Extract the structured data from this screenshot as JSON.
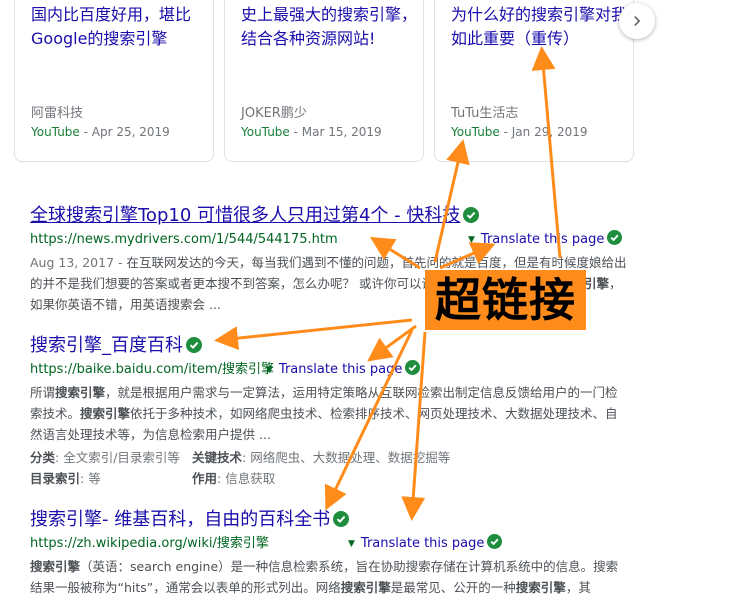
{
  "cards": [
    {
      "title": "国内比百度好用，堪比Google的搜索引擎",
      "author": "阿雷科技",
      "source": "YouTube",
      "date": "Apr 25, 2019"
    },
    {
      "title": "史上最强大的搜索引擎，结合各种资源网站!",
      "author": "JOKER鹏少",
      "source": "YouTube",
      "date": "Mar 15, 2019"
    },
    {
      "title": "为什么好的搜索引擎对我如此重要（重传）",
      "author": "TuTu生活志",
      "source": "YouTube",
      "date": "Jan 29, 2019"
    }
  ],
  "separator": " - ",
  "results": [
    {
      "title": "全球搜索引擎Top10 可惜很多人只用过第4个 - 快科技",
      "url": "https://news.mydrivers.com/1/544/544175.htm",
      "translate": "Translate this page",
      "date": "Aug 13, 2017 - ",
      "snippet_a": "在互联网发达的今天，每当我们遇到不懂的问题，首先问的就是百度，但是有时候度娘给出的并不是我们想要的答案或者更本搜不到答案，怎么办呢？ 或许你可以试试一下下面这个榜上大",
      "snippet_b": "搜索引擎",
      "snippet_c": "，如果你英语不错，用英语搜索会 ..."
    },
    {
      "title": "搜索引擎_百度百科",
      "url": "https://baike.baidu.com/item/搜索引擎",
      "translate": "Translate this page",
      "s1": "所谓",
      "s2": "搜索引擎",
      "s3": "，就是根据用户需求与一定算法，运用特定策略从互联网检索出制定信息反馈给用户的一门检索技术。",
      "s4": "搜索引擎",
      "s5": "依托于多种技术，如网络爬虫技术、检索排序技术、网页处理技术、大数据处理技术、自然语言处理技术等，为信息检索用户提供 ...",
      "facts": [
        {
          "label": "分类",
          "value": "全文索引/目录索引等"
        },
        {
          "label": "关键技术",
          "value": "网络爬虫、大数据处理、数据挖掘等"
        },
        {
          "label": "目录索引",
          "value": "等"
        },
        {
          "label": "作用",
          "value": "信息获取"
        }
      ]
    },
    {
      "title": "搜索引擎- 维基百科，自由的百科全书",
      "url": "https://zh.wikipedia.org/wiki/搜索引擎",
      "translate": "Translate this page",
      "s1": "搜索引擎",
      "s2": "（英语：search engine）是一种信息检索系统，旨在协助搜索存储在计算机系统中的信息。搜索结果一般被称为“hits”，通常会以表单的形式列出。网络",
      "s3": "搜索引擎",
      "s4": "是最常见、公开的一种",
      "s5": "搜索引擎",
      "s6": "，其"
    }
  ],
  "annotation": "超链接",
  "colors": {
    "link": "#1a0dab",
    "url": "#006621",
    "youtube": "#188038",
    "check": "#1e8e3e",
    "arrow": "#ff8c1a"
  },
  "icons": {
    "next": "chevron-right-icon",
    "verified": "verified-check-icon"
  }
}
